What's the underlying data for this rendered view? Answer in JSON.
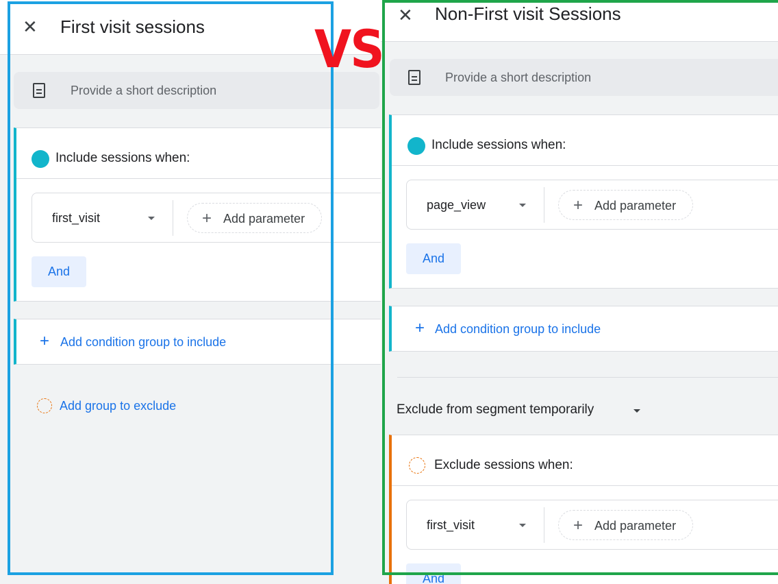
{
  "vs_label": "VS",
  "left": {
    "close_icon": "close-icon",
    "title": "First visit sessions",
    "description_placeholder": "Provide a short description",
    "include_title": "Include sessions when:",
    "event_name": "first_visit",
    "add_parameter_label": "Add parameter",
    "and_label": "And",
    "add_condition_group_label": "Add condition group to include",
    "add_exclude_group_label": "Add group to exclude"
  },
  "right": {
    "close_icon": "close-icon",
    "title": "Non-First visit Sessions",
    "description_placeholder": "Provide a short description",
    "include_title": "Include sessions when:",
    "event_name": "page_view",
    "add_parameter_label": "Add parameter",
    "and_label": "And",
    "add_condition_group_label": "Add condition group to include",
    "exclude_mode_label": "Exclude from segment temporarily",
    "exclude_title": "Exclude sessions when:",
    "exclude_event_name": "first_visit",
    "exclude_add_parameter_label": "Add parameter",
    "exclude_and_label": "And"
  },
  "colors": {
    "include_accent": "#12b5cb",
    "exclude_accent": "#e8710a",
    "link_blue": "#1a73e8",
    "left_frame": "#1ba1e2",
    "right_frame": "#1fa54a",
    "vs_red": "#f0131f"
  }
}
